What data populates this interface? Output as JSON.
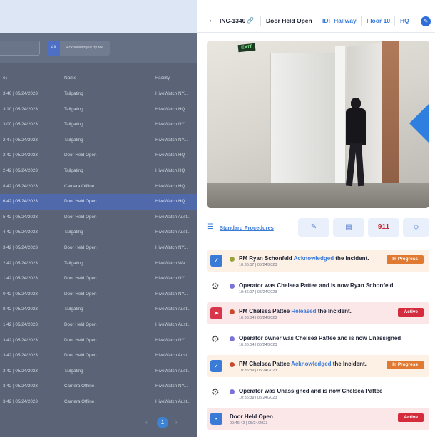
{
  "table": {
    "filter": {
      "all_label": "All",
      "acknowledged_label": "Acknowledged by Me"
    },
    "columns": [
      "e↓",
      "Name",
      "Facility"
    ],
    "rows": [
      {
        "time": "3:40 | 05/24/2023",
        "name": "Tailgating",
        "facility": "HiveWatch NY..."
      },
      {
        "time": "3:10 | 05/24/2023",
        "name": "Tailgating",
        "facility": "HiveWatch HQ"
      },
      {
        "time": "3:00 | 05/24/2023",
        "name": "Tailgating",
        "facility": "HiveWatch NY..."
      },
      {
        "time": "2:47 | 05/24/2023",
        "name": "Tailgating",
        "facility": "HiveWatch NY..."
      },
      {
        "time": "2:42 | 05/24/2023",
        "name": "Door Held Open",
        "facility": "HiveWatch HQ"
      },
      {
        "time": "2:42 | 05/24/2023",
        "name": "Tailgating",
        "facility": "HiveWatch HQ"
      },
      {
        "time": "8:42 | 05/24/2023",
        "name": "Camera Offline",
        "facility": "HiveWatch HQ"
      },
      {
        "time": "6:42 | 05/24/2023",
        "name": "Door Held Open",
        "facility": "HiveWatch HQ"
      },
      {
        "time": "5:42 | 05/24/2023",
        "name": "Door Held Open",
        "facility": "HiveWatch Aust..."
      },
      {
        "time": "4:42 | 05/24/2023",
        "name": "Tailgating",
        "facility": "HiveWatch Aust..."
      },
      {
        "time": "3:42 | 05/24/2023",
        "name": "Door Held Open",
        "facility": "HiveWatch NY..."
      },
      {
        "time": "2:42 | 05/24/2023",
        "name": "Tailgating",
        "facility": "HiveWatch Wa..."
      },
      {
        "time": "1:42 | 05/24/2023",
        "name": "Door Held Open",
        "facility": "HiveWatch NY..."
      },
      {
        "time": "0:42 | 05/24/2023",
        "name": "Door Held Open",
        "facility": "HiveWatch NY..."
      },
      {
        "time": "8:42 | 05/24/2023",
        "name": "Tailgating",
        "facility": "HiveWatch Aust..."
      },
      {
        "time": "1:42 | 05/24/2023",
        "name": "Door Held Open",
        "facility": "HiveWatch Aust..."
      },
      {
        "time": "3:42 | 05/24/2023",
        "name": "Door Held Open",
        "facility": "HiveWatch NY..."
      },
      {
        "time": "3:42 | 05/24/2023",
        "name": "Door Held Open",
        "facility": "HiveWatch Aust..."
      },
      {
        "time": "3:42 | 05/24/2023",
        "name": "Tailgating",
        "facility": "HiveWatch Aust..."
      },
      {
        "time": "3:42 | 05/24/2023",
        "name": "Camera Offline",
        "facility": "HiveWatch NY..."
      },
      {
        "time": "3:42 | 05/24/2023",
        "name": "Camera Offline",
        "facility": "HiveWatch Aust..."
      }
    ],
    "selected_row": 7,
    "pager": {
      "prev": "‹",
      "current": "1",
      "next": "›"
    }
  },
  "header": {
    "back": "←",
    "incident_id": "INC-1340",
    "link_icon": "🔗",
    "type": "Door Held Open",
    "location": "IDF Hallway",
    "floor": "Floor 10",
    "site": "HQ",
    "pin_icon": "✎"
  },
  "video": {
    "exit_sign": "EXIT"
  },
  "procedures": {
    "list_icon": "☰",
    "link": "Standard Procedures",
    "note_icon": "✎",
    "message_icon": "▤",
    "call_label": "911",
    "shield_icon": "◇"
  },
  "timeline": [
    {
      "kind": "user",
      "color": "orange",
      "icon": "✓",
      "actor": "PM Ryan Schonfeld",
      "action": "Acknowledged",
      "rest": " the Incident.",
      "time": "10:36:07 | 05/24/2023",
      "badge": "In Progress"
    },
    {
      "kind": "system",
      "text": "Operator was Chelsea Pattee and is now Ryan Schonfeld",
      "time": "10:36:07 | 05/24/2023"
    },
    {
      "kind": "user",
      "color": "pink",
      "icon": "➤",
      "actor": "PM Chelsea Pattee",
      "action": "Released",
      "rest": " the Incident.",
      "time": "10:36:04 | 05/24/2023",
      "badge": "Active"
    },
    {
      "kind": "system",
      "text": "Operator owner was Chelsea Pattee and is now Unassigned",
      "time": "10:36:04 | 05/24/2023"
    },
    {
      "kind": "user",
      "color": "orange",
      "icon": "✓",
      "actor": "PM Chelsea Pattee",
      "action": "Acknowledged",
      "rest": " the Incident.",
      "time": "10:35:39 | 05/24/2023",
      "badge": "In Progress"
    },
    {
      "kind": "system",
      "text": "Operator was Unassigned and is now Chelsea Pattee",
      "time": "10:35:39 | 05/24/2023"
    },
    {
      "kind": "event",
      "color": "pink",
      "icon": "▪",
      "actor": "Door Held Open",
      "time": "00:46:42 | 05/24/2023",
      "badge": "Active"
    }
  ],
  "colors": {
    "accent": "#3b7bd8",
    "in_progress": "#e07a32",
    "active": "#d42c3c"
  }
}
